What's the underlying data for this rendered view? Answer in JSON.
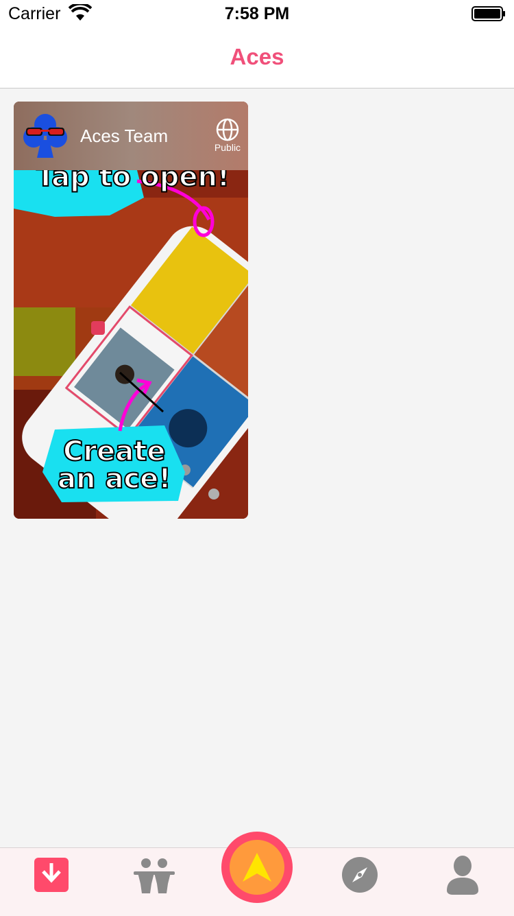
{
  "status_bar": {
    "carrier": "Carrier",
    "time": "7:58 PM"
  },
  "nav": {
    "title": "Aces"
  },
  "card": {
    "team_name": "Aces Team",
    "visibility_label": "Public",
    "art_caption_top": "Tap to open!",
    "art_caption_bottom_line1": "Create",
    "art_caption_bottom_line2": "an ace!"
  },
  "tab_bar": {
    "items": [
      {
        "icon": "inbox-down-icon"
      },
      {
        "icon": "friends-icon"
      },
      {
        "icon": "create-ace-icon"
      },
      {
        "icon": "compass-icon"
      },
      {
        "icon": "profile-icon"
      }
    ]
  },
  "colors": {
    "accent": "#f0507a",
    "tab_active": "#ff4a6b",
    "tab_inactive": "#8a8a8a",
    "create_outer": "#ff4a6b",
    "create_inner": "#ff9a3c",
    "create_arrow": "#ffe500"
  }
}
